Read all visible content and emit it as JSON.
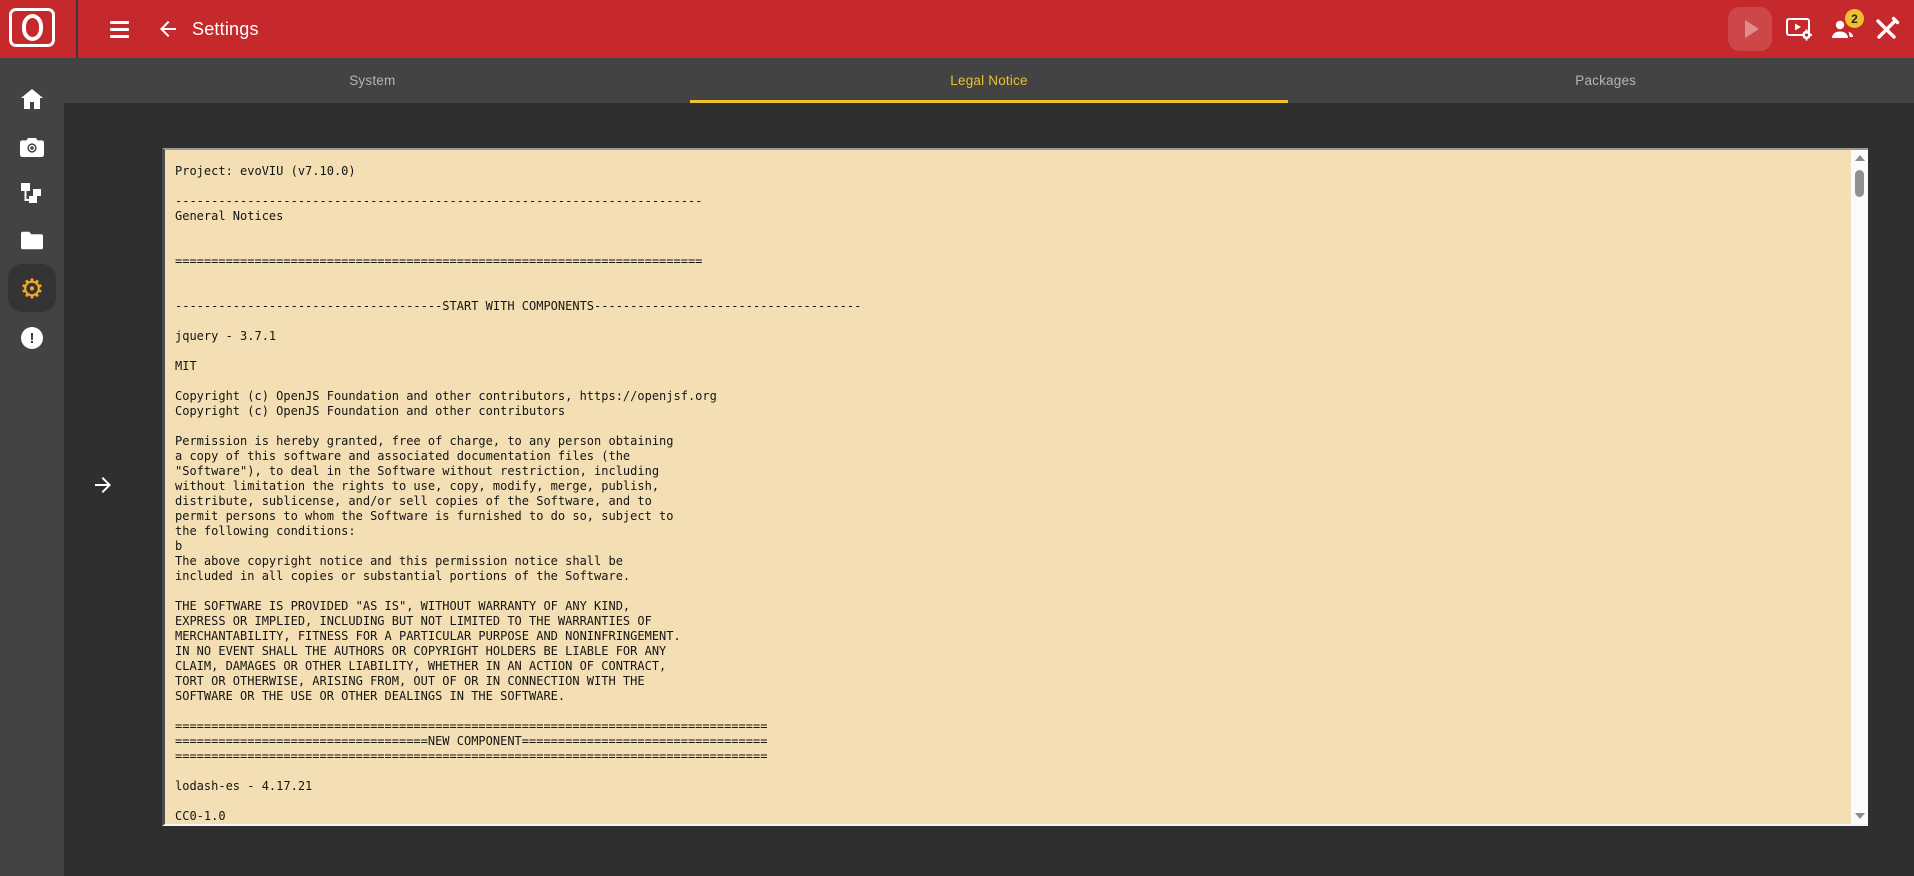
{
  "header": {
    "title": "Settings",
    "notification_count": "2",
    "icons": [
      "menu-icon",
      "back-arrow-icon",
      "play-icon",
      "video-settings-icon",
      "users-icon",
      "service-tools-icon"
    ]
  },
  "tabs": [
    {
      "label": "System",
      "active": false
    },
    {
      "label": "Legal Notice",
      "active": true
    },
    {
      "label": "Packages",
      "active": false
    }
  ],
  "sidebar": {
    "items": [
      {
        "name": "home",
        "icon": "home-icon",
        "active": false
      },
      {
        "name": "camera",
        "icon": "camera-icon",
        "active": false
      },
      {
        "name": "workflow",
        "icon": "workflow-icon",
        "active": false
      },
      {
        "name": "files",
        "icon": "folder-icon",
        "active": false
      },
      {
        "name": "settings",
        "icon": "gear-icon",
        "active": true
      },
      {
        "name": "alerts",
        "icon": "alert-icon",
        "active": false
      }
    ],
    "gear_glyph": "⚙",
    "alert_glyph": "!"
  },
  "colors": {
    "header_red": "#c5292b",
    "accent_yellow": "#eec12f",
    "panel_gray": "#434343",
    "content_gray": "#2f2f2f",
    "notice_beige": "#f3dfb3",
    "gear_orange": "#f2a72e"
  },
  "legal_notice": {
    "lines": [
      "Project: evoVIU (v7.10.0)",
      "",
      "-------------------------------------------------------------------------",
      "General Notices",
      "",
      "",
      "=========================================================================",
      "",
      "",
      "-------------------------------------START WITH COMPONENTS-------------------------------------",
      "",
      "jquery - 3.7.1",
      "",
      "MIT",
      "",
      "Copyright (c) OpenJS Foundation and other contributors, https://openjsf.org",
      "Copyright (c) OpenJS Foundation and other contributors",
      "",
      "Permission is hereby granted, free of charge, to any person obtaining",
      "a copy of this software and associated documentation files (the",
      "\"Software\"), to deal in the Software without restriction, including",
      "without limitation the rights to use, copy, modify, merge, publish,",
      "distribute, sublicense, and/or sell copies of the Software, and to",
      "permit persons to whom the Software is furnished to do so, subject to",
      "the following conditions:",
      "b",
      "The above copyright notice and this permission notice shall be",
      "included in all copies or substantial portions of the Software.",
      "",
      "THE SOFTWARE IS PROVIDED \"AS IS\", WITHOUT WARRANTY OF ANY KIND,",
      "EXPRESS OR IMPLIED, INCLUDING BUT NOT LIMITED TO THE WARRANTIES OF",
      "MERCHANTABILITY, FITNESS FOR A PARTICULAR PURPOSE AND NONINFRINGEMENT.",
      "IN NO EVENT SHALL THE AUTHORS OR COPYRIGHT HOLDERS BE LIABLE FOR ANY",
      "CLAIM, DAMAGES OR OTHER LIABILITY, WHETHER IN AN ACTION OF CONTRACT,",
      "TORT OR OTHERWISE, ARISING FROM, OUT OF OR IN CONNECTION WITH THE",
      "SOFTWARE OR THE USE OR OTHER DEALINGS IN THE SOFTWARE.",
      "",
      "==================================================================================",
      "===================================NEW COMPONENT==================================",
      "==================================================================================",
      "",
      "lodash-es - 4.17.21",
      "",
      "CC0-1.0"
    ]
  }
}
